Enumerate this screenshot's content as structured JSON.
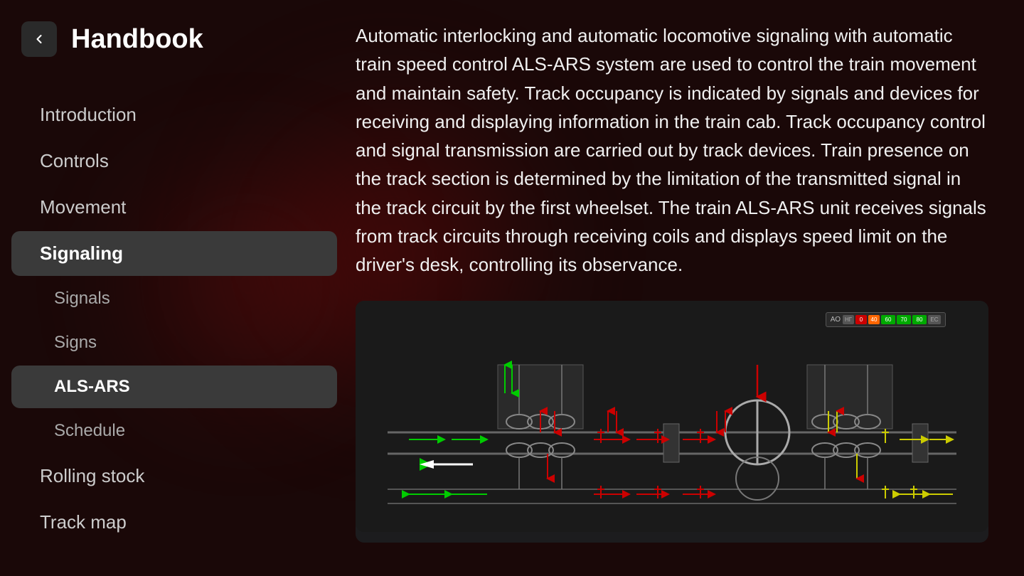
{
  "app": {
    "title": "Handbook"
  },
  "sidebar": {
    "back_label": "back",
    "items": [
      {
        "id": "introduction",
        "label": "Introduction",
        "level": "top",
        "active": false
      },
      {
        "id": "controls",
        "label": "Controls",
        "level": "top",
        "active": false
      },
      {
        "id": "movement",
        "label": "Movement",
        "level": "top",
        "active": false
      },
      {
        "id": "signaling",
        "label": "Signaling",
        "level": "top",
        "active": true
      },
      {
        "id": "signals",
        "label": "Signals",
        "level": "sub",
        "active": false
      },
      {
        "id": "signs",
        "label": "Signs",
        "level": "sub",
        "active": false
      },
      {
        "id": "als-ars",
        "label": "ALS-ARS",
        "level": "sub",
        "active": true
      },
      {
        "id": "schedule",
        "label": "Schedule",
        "level": "sub",
        "active": false
      },
      {
        "id": "rolling-stock",
        "label": "Rolling stock",
        "level": "top",
        "active": false
      },
      {
        "id": "track-map",
        "label": "Track map",
        "level": "top",
        "active": false
      }
    ]
  },
  "content": {
    "text": "Automatic interlocking and automatic locomotive signaling with automatic train speed control ALS-ARS system are used to control the train movement and maintain safety. Track occupancy is indicated by signals and devices for receiving and displaying information in the train cab. Track occupancy control and signal transmission are carried out by track devices. Train presence on the track section is determined by the limitation of the transmitted signal in the track circuit by the first wheelset. The train ALS-ARS unit receives signals from track circuits through receiving coils and displays speed limit on the driver's desk, controlling its observance."
  },
  "diagram": {
    "panel_label": "АО",
    "speeds": [
      "НГ",
      "0",
      "40",
      "60",
      "70",
      "80",
      "ЕС"
    ]
  },
  "colors": {
    "sidebar_bg": "#1a0808",
    "active_item": "#3a3a3a",
    "accent_red": "#cc0000",
    "accent_green": "#00aa00",
    "text_primary": "#ffffff",
    "text_secondary": "#cccccc",
    "diagram_bg": "#1a1a1a"
  }
}
